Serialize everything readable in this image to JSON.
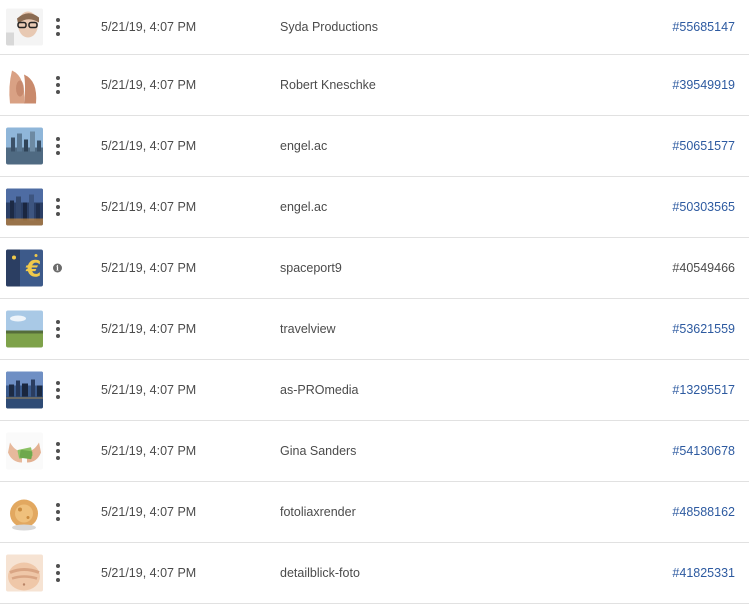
{
  "colors": {
    "link": "#2d5aa0",
    "text": "#4b4b4b",
    "divider": "#e1e1e1"
  },
  "rows": [
    {
      "thumbnail": "woman-with-glasses",
      "action_icon": "more-vertical-icon",
      "date": "5/21/19, 4:07 PM",
      "author": "Syda Productions",
      "id": "#55685147",
      "id_is_link": true
    },
    {
      "thumbnail": "skin-closeup",
      "action_icon": "more-vertical-icon",
      "date": "5/21/19, 4:07 PM",
      "author": "Robert Kneschke",
      "id": "#39549919",
      "id_is_link": true
    },
    {
      "thumbnail": "city-skyline",
      "action_icon": "more-vertical-icon",
      "date": "5/21/19, 4:07 PM",
      "author": "engel.ac",
      "id": "#50651577",
      "id_is_link": true
    },
    {
      "thumbnail": "city-skyline-dusk",
      "action_icon": "more-vertical-icon",
      "date": "5/21/19, 4:07 PM",
      "author": "engel.ac",
      "id": "#50303565",
      "id_is_link": true
    },
    {
      "thumbnail": "euro-sign",
      "action_icon": "info-icon",
      "date": "5/21/19, 4:07 PM",
      "author": "spaceport9",
      "id": "#40549466",
      "id_is_link": false
    },
    {
      "thumbnail": "green-field",
      "action_icon": "more-vertical-icon",
      "date": "5/21/19, 4:07 PM",
      "author": "travelview",
      "id": "#53621559",
      "id_is_link": true
    },
    {
      "thumbnail": "city-at-night",
      "action_icon": "more-vertical-icon",
      "date": "5/21/19, 4:07 PM",
      "author": "as-PROmedia",
      "id": "#13295517",
      "id_is_link": true
    },
    {
      "thumbnail": "hands-with-money",
      "action_icon": "more-vertical-icon",
      "date": "5/21/19, 4:07 PM",
      "author": "Gina Sanders",
      "id": "#54130678",
      "id_is_link": true
    },
    {
      "thumbnail": "head-render",
      "action_icon": "more-vertical-icon",
      "date": "5/21/19, 4:07 PM",
      "author": "fotoliaxrender",
      "id": "#48588162",
      "id_is_link": true
    },
    {
      "thumbnail": "belly-hands",
      "action_icon": "more-vertical-icon",
      "date": "5/21/19, 4:07 PM",
      "author": "detailblick-foto",
      "id": "#41825331",
      "id_is_link": true
    }
  ]
}
